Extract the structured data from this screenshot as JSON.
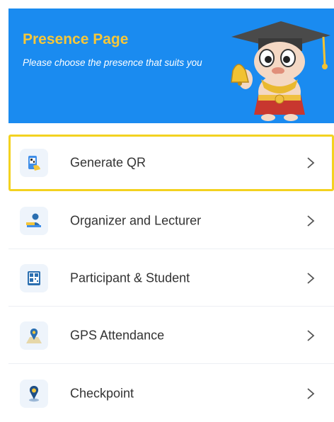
{
  "header": {
    "title": "Presence Page",
    "subtitle": "Please choose the presence that suits you",
    "mascot": "mascot-illustration"
  },
  "menu": {
    "items": [
      {
        "label": "Generate QR",
        "icon": "qr-phone-icon",
        "highlighted": true
      },
      {
        "label": "Organizer and Lecturer",
        "icon": "lecturer-icon"
      },
      {
        "label": "Participant & Student",
        "icon": "qr-code-icon"
      },
      {
        "label": "GPS Attendance",
        "icon": "map-pin-icon"
      },
      {
        "label": "Checkpoint",
        "icon": "location-pin-icon"
      }
    ]
  },
  "colors": {
    "banner": "#1a8bf0",
    "title": "#f6c73a",
    "highlight_border": "#f3d21f",
    "icon_bg": "#eef4fb"
  }
}
